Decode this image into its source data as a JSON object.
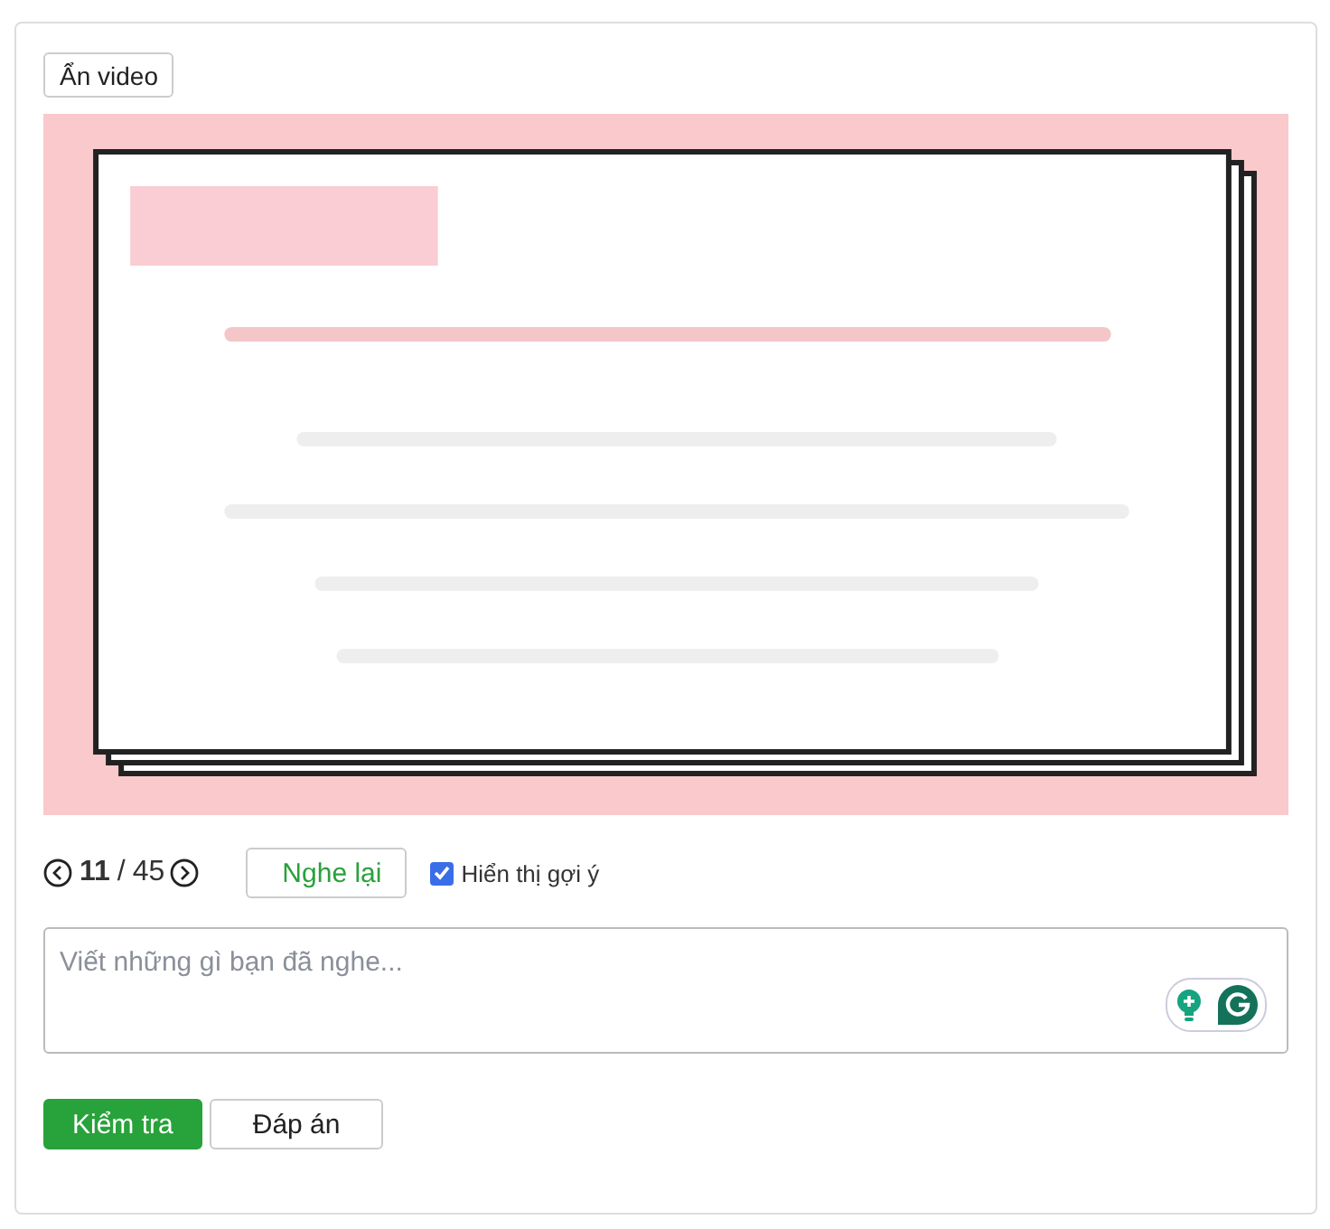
{
  "toggle_video_button": {
    "label": "Ẩn video"
  },
  "pager": {
    "current": "11",
    "separator": "/",
    "total": "45"
  },
  "replay_button": {
    "label": "Nghe lại"
  },
  "hint_checkbox": {
    "label": "Hiển thị gợi ý",
    "checked": true
  },
  "answer": {
    "placeholder": "Viết những gì bạn đã nghe..."
  },
  "actions": [
    {
      "label": "Kiểm tra",
      "kind": "primary"
    },
    {
      "label": "Đáp án",
      "kind": "default"
    }
  ]
}
